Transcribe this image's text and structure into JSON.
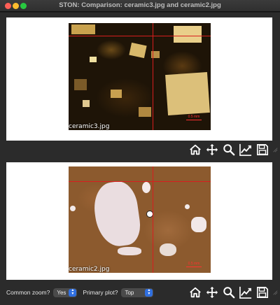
{
  "window": {
    "title": "STON: Comparison: ceramic3.jpg and ceramic2.jpg"
  },
  "panels": [
    {
      "image_label": "ceramic3.jpg",
      "scalebar_text": "0.5 mm"
    },
    {
      "image_label": "ceramic2.jpg",
      "scalebar_text": "0.5 mm"
    }
  ],
  "toolbar": {
    "buttons": [
      "home-icon",
      "pan-icon",
      "zoom-icon",
      "subplots-icon",
      "save-icon"
    ]
  },
  "controls": {
    "common_zoom_label": "Common zoom?",
    "common_zoom_value": "Yes",
    "primary_plot_label": "Primary plot?",
    "primary_plot_value": "Top"
  },
  "colors": {
    "crosshair": "#d81e1e",
    "select_accent": "#2f6fe0"
  }
}
